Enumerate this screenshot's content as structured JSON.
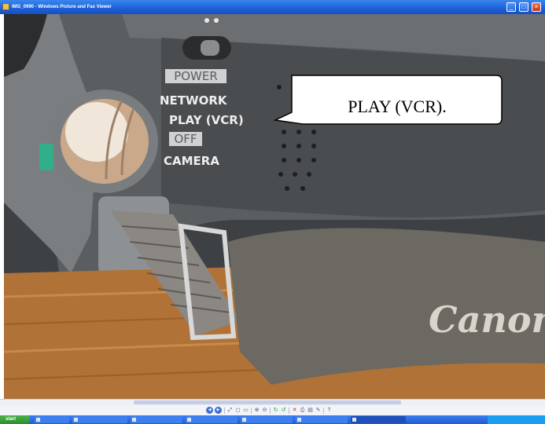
{
  "window": {
    "title": "IMG_0990 - Windows Picture and Fax Viewer",
    "icon": "picture-viewer-icon",
    "controls": {
      "minimize": "_",
      "maximize": "□",
      "close": "×"
    }
  },
  "photo": {
    "dial_labels": [
      "POWER",
      "NETWORK",
      "PLAY (VCR)",
      "OFF",
      "CAMERA"
    ],
    "callout": "PLAY (VCR).",
    "strap_brand": "Canon"
  },
  "toolbar": {
    "buttons": [
      {
        "name": "previous-image-icon",
        "glyph": "◀"
      },
      {
        "name": "next-image-icon",
        "glyph": "▶"
      },
      {
        "name": "best-fit-icon",
        "glyph": "⤢"
      },
      {
        "name": "actual-size-icon",
        "glyph": "◻"
      },
      {
        "name": "slideshow-icon",
        "glyph": "▭"
      },
      {
        "name": "zoom-in-icon",
        "glyph": "⊕"
      },
      {
        "name": "zoom-out-icon",
        "glyph": "⊖"
      },
      {
        "name": "rotate-clockwise-icon",
        "glyph": "↻"
      },
      {
        "name": "rotate-counterclockwise-icon",
        "glyph": "↺"
      },
      {
        "name": "delete-icon",
        "glyph": "✕"
      },
      {
        "name": "print-icon",
        "glyph": "⎙"
      },
      {
        "name": "copy-to-icon",
        "glyph": "▤"
      },
      {
        "name": "edit-icon",
        "glyph": "✎"
      },
      {
        "name": "help-icon",
        "glyph": "?"
      }
    ]
  },
  "taskbar": {
    "start_label": "start",
    "tasks": [
      {
        "label": "",
        "icon": "quick-launch-icon"
      },
      {
        "label": "",
        "icon": "folder-icon"
      },
      {
        "label": "",
        "icon": "document-icon"
      },
      {
        "label": "",
        "icon": "document-icon"
      },
      {
        "label": "",
        "icon": "document-icon"
      },
      {
        "label": "",
        "icon": "browser-icon"
      },
      {
        "label": "",
        "icon": "picture-viewer-icon"
      }
    ],
    "clock": ""
  },
  "colors": {
    "titlebar": "#1c5fd6",
    "taskbar": "#2458d8",
    "start": "#2e8b2e"
  }
}
